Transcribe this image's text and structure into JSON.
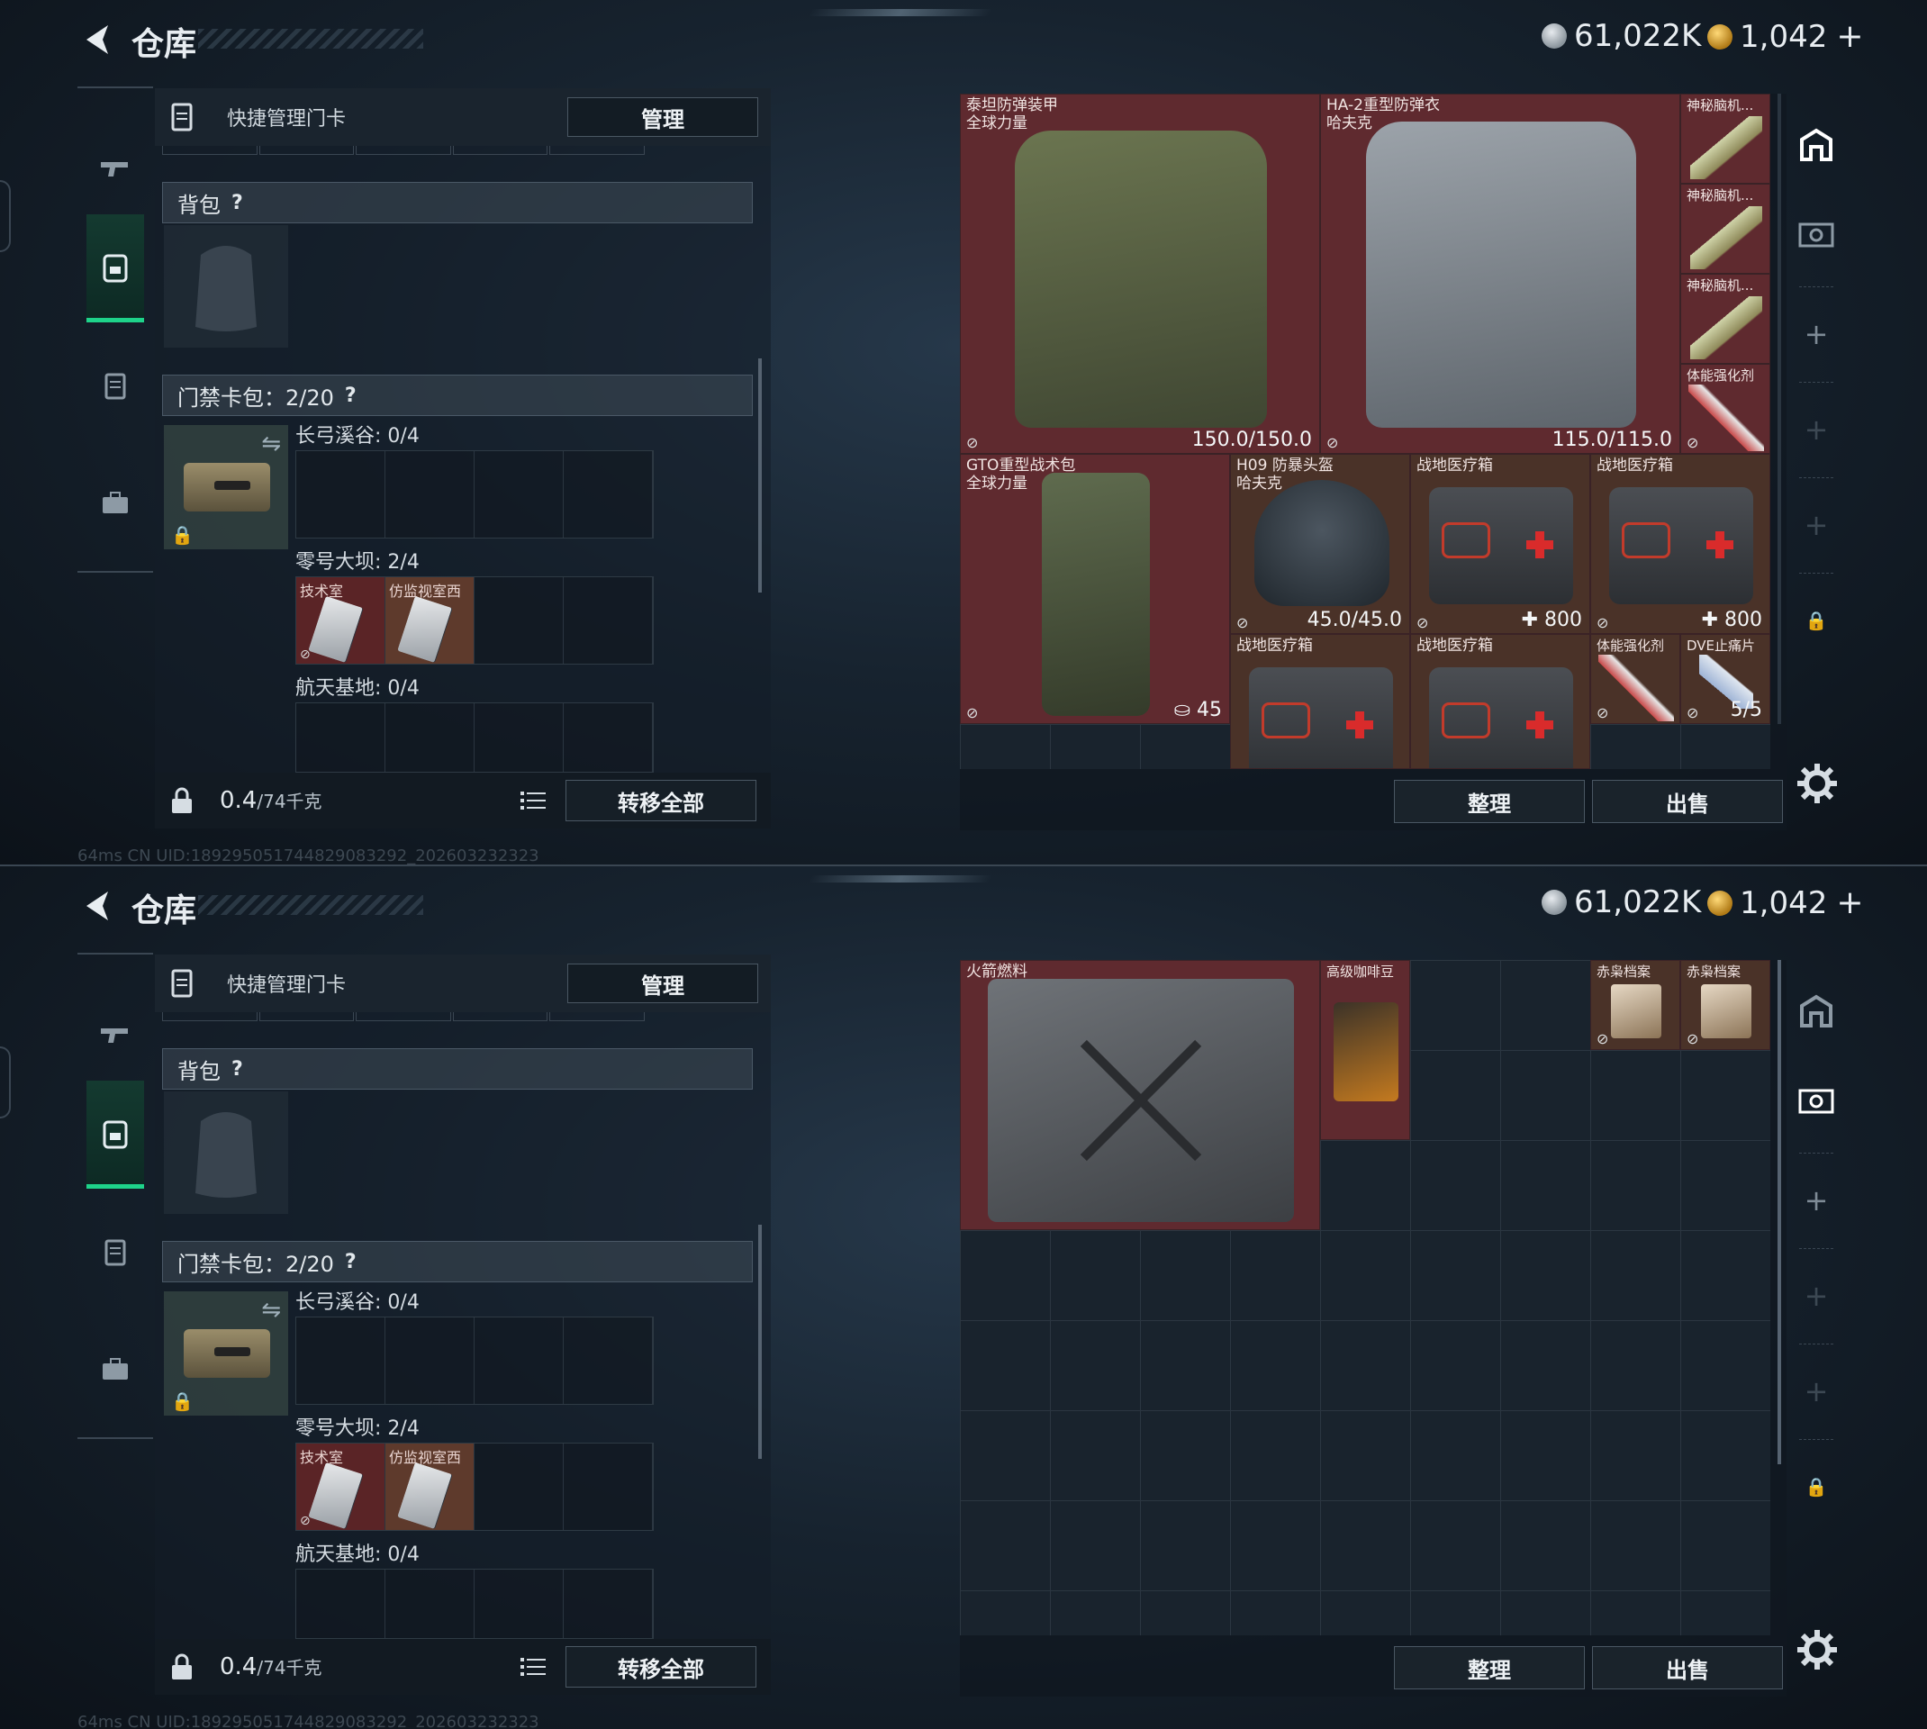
{
  "header": {
    "title": "仓库",
    "currency1": "61,022K",
    "currency2": "1,042",
    "plus": "+"
  },
  "left": {
    "quick_label": "快捷管理门卡",
    "manage_button": "管理",
    "backpack_label": "背包",
    "help_mark": "?",
    "card_section_label": "门禁卡包：2/20",
    "swap_icon": "⇋",
    "lock_icon": "🔒",
    "zones": [
      {
        "label": "长弓溪谷: 0/4"
      },
      {
        "label": "零号大坝: 2/4",
        "cards": [
          "技术室",
          "仿监视室西"
        ]
      },
      {
        "label": "航天基地: 0/4"
      }
    ],
    "weight_value": "0.4",
    "weight_total": "/74千克",
    "transfer_all": "转移全部"
  },
  "statusbar": "64ms     CN UID:189295051744829083292_202603232323",
  "top_items": {
    "armor1": {
      "name": "泰坦防弹装甲\n全球力量",
      "value": "150.0/150.0"
    },
    "armor2": {
      "name": "HA-2重型防弹衣\n哈夫克",
      "value": "115.0/115.0"
    },
    "mystic1": "神秘脑机...",
    "mystic2": "神秘脑机...",
    "mystic3": "神秘脑机...",
    "stim1": "体能强化剂",
    "backpack": {
      "name": "GTO重型战术包\n全球力量",
      "value": "45"
    },
    "helmet": {
      "name": "H09 防暴头盔\n哈夫克",
      "value": "45.0/45.0"
    },
    "med1": {
      "name": "战地医疗箱",
      "value": "800"
    },
    "med2": {
      "name": "战地医疗箱",
      "value": "800"
    },
    "med3": "战地医疗箱",
    "med4": "战地医疗箱",
    "stim2": "体能强化剂",
    "painkiller": {
      "name": "DVE止痛片",
      "value": "5/5"
    }
  },
  "bottom_items": {
    "fuel": "火箭燃料",
    "coffee": "高级咖啡豆",
    "file1": "赤枭档案",
    "file2": "赤枭档案"
  },
  "buttons": {
    "sort": "整理",
    "sell": "出售"
  },
  "no_trade_icon": "⊘"
}
